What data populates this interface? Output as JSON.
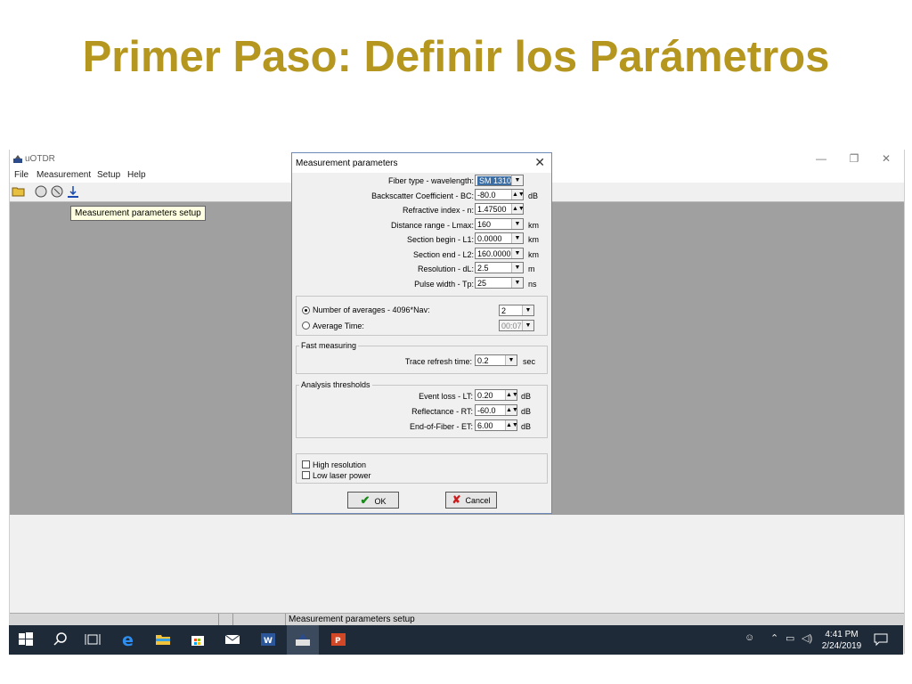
{
  "slide": {
    "title": "Primer Paso: Definir los Parámetros"
  },
  "app": {
    "title": "uOTDR",
    "menu": [
      "File",
      "Measurement",
      "Setup",
      "Help"
    ],
    "tooltip": "Measurement parameters setup",
    "status_text": "Measurement parameters setup",
    "window_controls": {
      "minimize": "—",
      "restore": "❐",
      "close": "✕"
    }
  },
  "dialog": {
    "title": "Measurement parameters",
    "close": "✕",
    "fields": {
      "fiber_type": {
        "label": "Fiber type - wavelength:",
        "value": "SM 1310"
      },
      "backscatter": {
        "label": "Backscatter Coefficient - BC:",
        "value": "-80.0",
        "unit": "dB"
      },
      "refractive": {
        "label": "Refractive index - n:",
        "value": "1.47500"
      },
      "distance": {
        "label": "Distance range - Lmax:",
        "value": "160",
        "unit": "km"
      },
      "section_begin": {
        "label": "Section begin - L1:",
        "value": "0.0000",
        "unit": "km"
      },
      "section_end": {
        "label": "Section end - L2:",
        "value": "160.0000",
        "unit": "km"
      },
      "resolution": {
        "label": "Resolution - dL:",
        "value": "2.5",
        "unit": "m"
      },
      "pulse_width": {
        "label": "Pulse width - Tp:",
        "value": "25",
        "unit": "ns"
      }
    },
    "averages": {
      "number_label": "Number of averages - 4096*Nav:",
      "number_value": "2",
      "time_label": "Average Time:",
      "time_value": "00:07"
    },
    "fast": {
      "title": "Fast measuring",
      "refresh_label": "Trace refresh time:",
      "refresh_value": "0.2",
      "refresh_unit": "sec"
    },
    "analysis": {
      "title": "Analysis thresholds",
      "event_label": "Event loss - LT:",
      "event_value": "0.20",
      "event_unit": "dB",
      "reflect_label": "Reflectance - RT:",
      "reflect_value": "-60.0",
      "reflect_unit": "dB",
      "eof_label": "End-of-Fiber - ET:",
      "eof_value": "6.00",
      "eof_unit": "dB"
    },
    "options": {
      "high_res": "High resolution",
      "low_laser": "Low laser power"
    },
    "buttons": {
      "ok": "OK",
      "cancel": "Cancel"
    }
  },
  "taskbar": {
    "time": "4:41 PM",
    "date": "2/24/2019"
  },
  "colors": {
    "title_gold": "#b5961f",
    "workspace_gray": "#a0a0a0",
    "taskbar": "#1e2a38",
    "selection": "#3a6ea5"
  }
}
